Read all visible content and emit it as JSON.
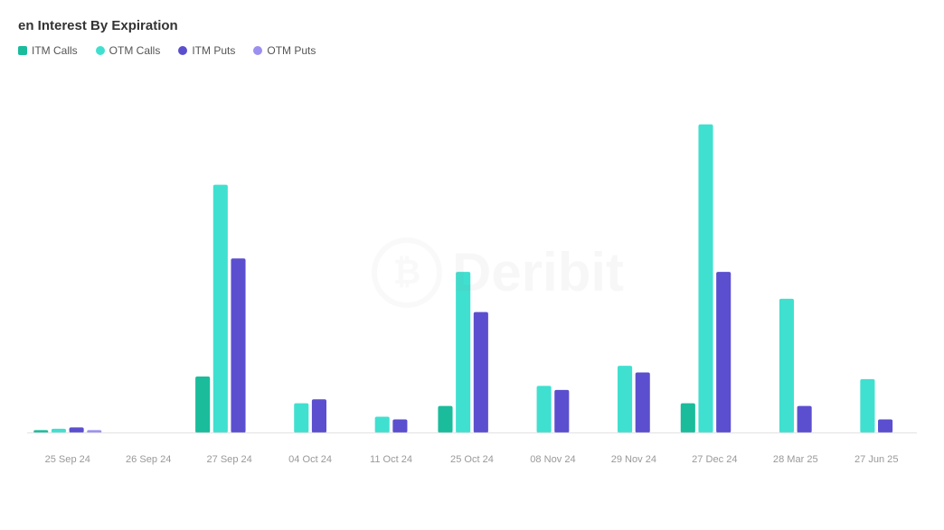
{
  "title": "en Interest By Expiration",
  "legend": [
    {
      "label": "ITM Calls",
      "color": "#1abc9c",
      "shape": "square"
    },
    {
      "label": "OTM Calls",
      "color": "#40e0d0",
      "shape": "circle"
    },
    {
      "label": "ITM Puts",
      "color": "#5b4fcf",
      "shape": "circle"
    },
    {
      "label": "OTM Puts",
      "color": "#9b8fef",
      "shape": "circle"
    }
  ],
  "watermark": "Deribit",
  "xLabels": [
    "25 Sep 24",
    "26 Sep 24",
    "27 Sep 24",
    "04 Oct 24",
    "11 Oct 24",
    "25 Oct 24",
    "08 Nov 24",
    "29 Nov 24",
    "27 Dec 24",
    "28 Mar 25",
    "27 Jun 25"
  ],
  "bars": [
    {
      "label": "25 Sep 24",
      "itm_calls": 2,
      "otm_calls": 3,
      "itm_puts": 4,
      "otm_puts": 2
    },
    {
      "label": "26 Sep 24",
      "itm_calls": 0,
      "otm_calls": 0,
      "itm_puts": 0,
      "otm_puts": 0
    },
    {
      "label": "27 Sep 24",
      "itm_calls": 42,
      "otm_calls": 185,
      "itm_puts": 130,
      "otm_puts": 0
    },
    {
      "label": "04 Oct 24",
      "itm_calls": 0,
      "otm_calls": 22,
      "itm_puts": 25,
      "otm_puts": 0
    },
    {
      "label": "11 Oct 24",
      "itm_calls": 0,
      "otm_calls": 12,
      "itm_puts": 10,
      "otm_puts": 0
    },
    {
      "label": "25 Oct 24",
      "itm_calls": 20,
      "otm_calls": 120,
      "itm_puts": 90,
      "otm_puts": 0
    },
    {
      "label": "08 Nov 24",
      "itm_calls": 0,
      "otm_calls": 35,
      "itm_puts": 32,
      "otm_puts": 0
    },
    {
      "label": "29 Nov 24",
      "itm_calls": 0,
      "otm_calls": 50,
      "itm_puts": 45,
      "otm_puts": 0
    },
    {
      "label": "27 Dec 24",
      "itm_calls": 22,
      "otm_calls": 230,
      "itm_puts": 120,
      "otm_puts": 0
    },
    {
      "label": "28 Mar 25",
      "itm_calls": 0,
      "otm_calls": 100,
      "itm_puts": 20,
      "otm_puts": 0
    },
    {
      "label": "27 Jun 25",
      "itm_calls": 0,
      "otm_calls": 40,
      "itm_puts": 10,
      "otm_puts": 0
    }
  ]
}
